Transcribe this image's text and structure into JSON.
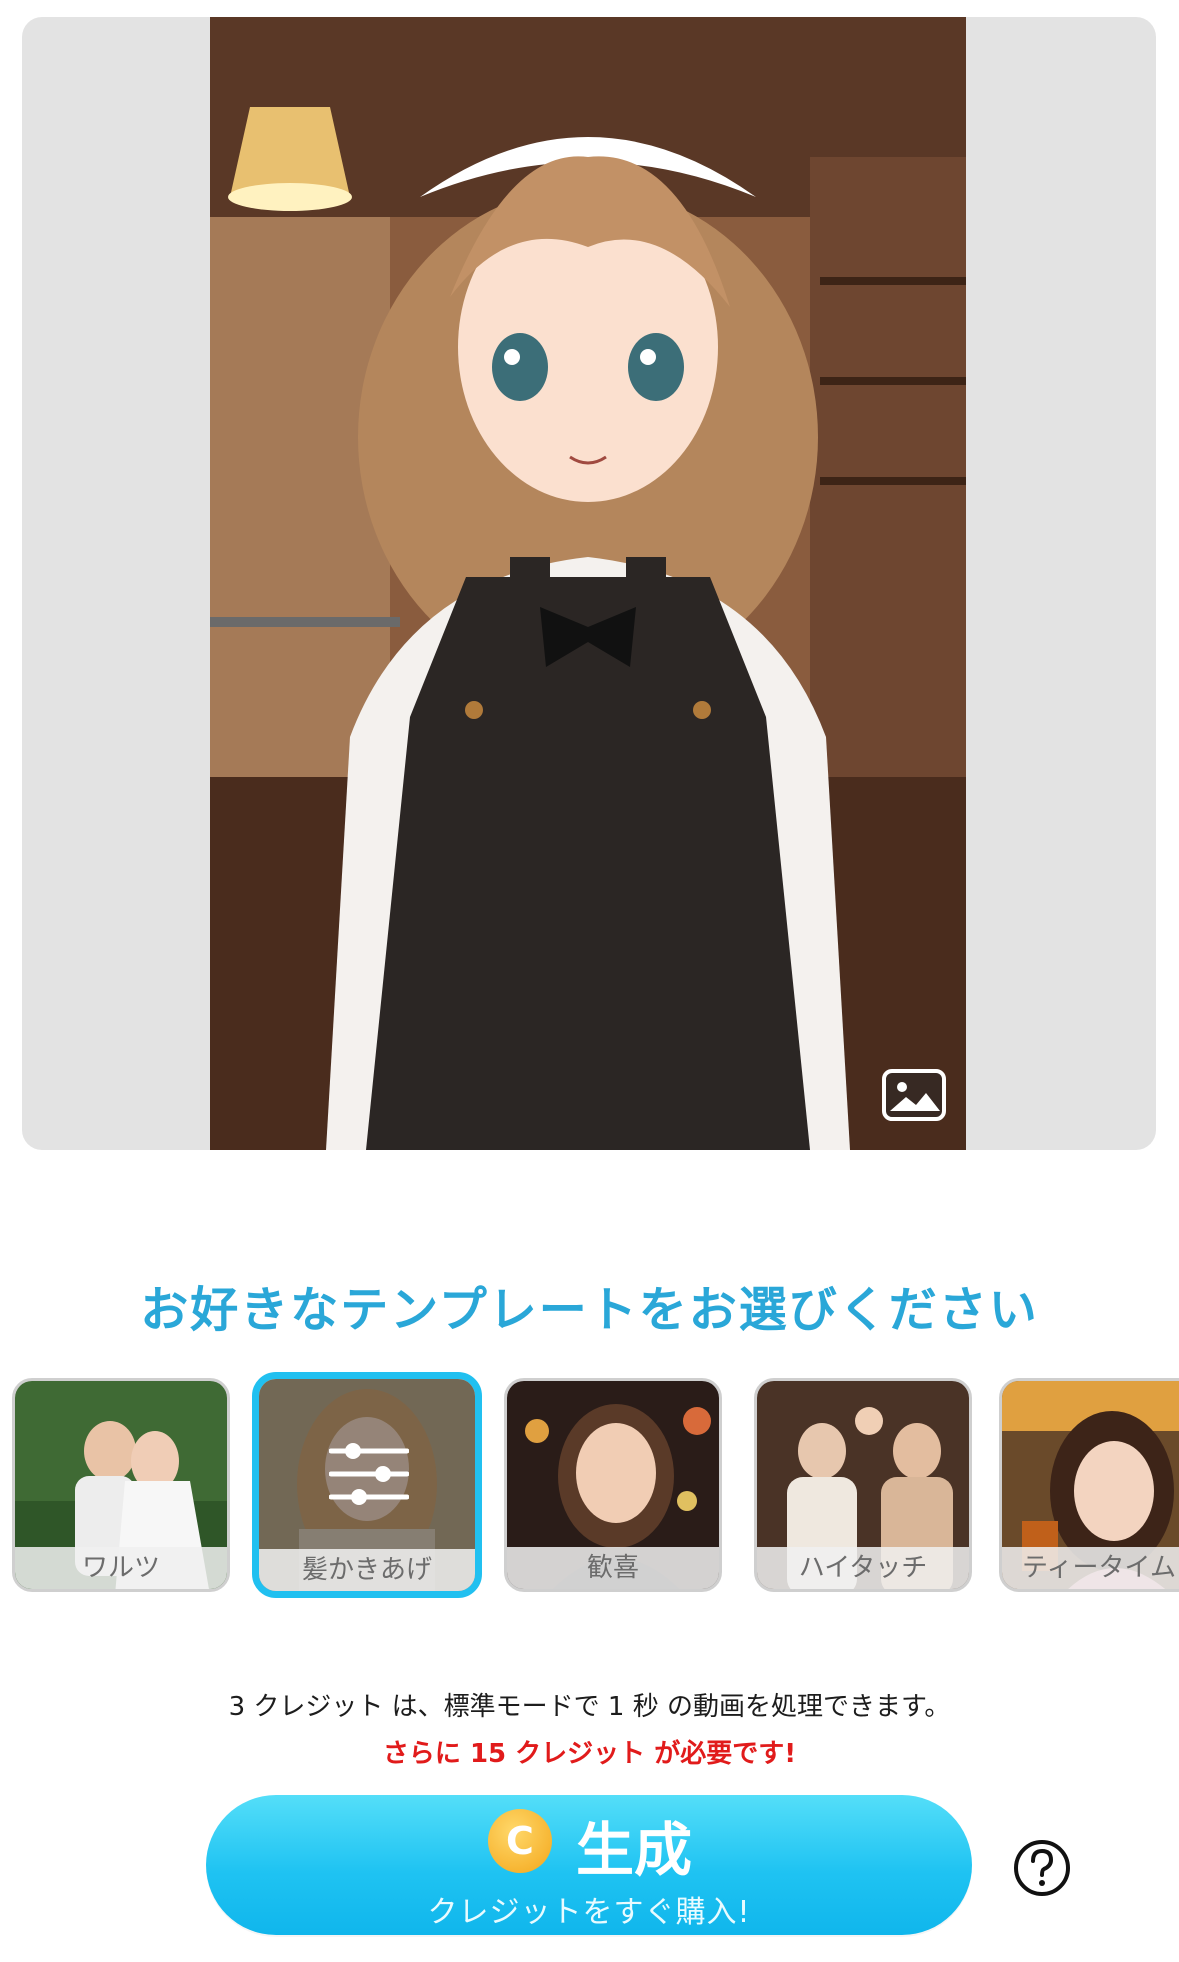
{
  "preview": {
    "image_icon": "image-icon"
  },
  "title": "お好きなテンプレートをお選びください",
  "templates": [
    {
      "label": "ワルツ",
      "selected": false
    },
    {
      "label": "髪かきあげ",
      "selected": true,
      "overlay_icon": "sliders-icon"
    },
    {
      "label": "歓喜",
      "selected": false
    },
    {
      "label": "ハイタッチ",
      "selected": false
    },
    {
      "label": "ティータイム",
      "selected": false
    }
  ],
  "info": {
    "line1": "3 クレジット は、標準モードで 1 秒 の動画を処理できます。",
    "line2": "さらに 15 クレジット が必要です!"
  },
  "generate": {
    "coin_letter": "C",
    "label": "生成",
    "sublabel": "クレジットをすぐ購入!"
  },
  "help_icon": "question-circle-icon",
  "colors": {
    "accent": "#2aa7d8",
    "button": "#1fc3f2",
    "warning": "#e11b1b",
    "selected_border": "#21c0f0"
  }
}
